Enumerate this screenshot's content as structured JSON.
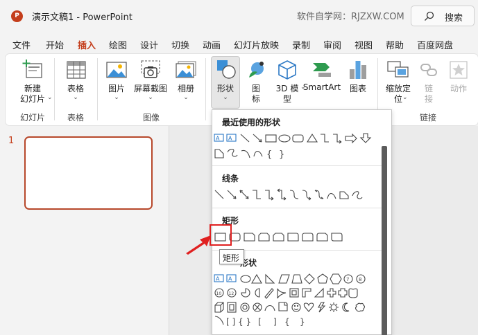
{
  "titlebar": {
    "app_icon": "P",
    "doc_title": "演示文稿1  -  PowerPoint",
    "watermark": "软件自学网：RJZXW.COM",
    "search_label": "搜索"
  },
  "menu": [
    "文件",
    "开始",
    "插入",
    "绘图",
    "设计",
    "切换",
    "动画",
    "幻灯片放映",
    "录制",
    "审阅",
    "视图",
    "帮助",
    "百度网盘"
  ],
  "active_tab": "插入",
  "ribbon": {
    "new_slide": [
      "新建",
      "幻灯片"
    ],
    "table": "表格",
    "picture": "图片",
    "screenshot": "屏幕截图",
    "album": "相册",
    "shapes": "形状",
    "icons": [
      "图",
      "标"
    ],
    "model3d": [
      "3D 模",
      "型"
    ],
    "smartart": "SmartArt",
    "chart": "图表",
    "zoom": [
      "缩放定",
      "位"
    ],
    "link": [
      "链",
      "接"
    ],
    "action": "动作",
    "groups": {
      "slides": "幻灯片",
      "tables": "表格",
      "images": "图像",
      "links": "链接"
    }
  },
  "slides": {
    "number": "1"
  },
  "dropdown": {
    "sections": [
      "最近使用的形状",
      "线条",
      "矩形",
      "基本形状"
    ],
    "basic_shapes_visible": "形状"
  },
  "tooltip": "矩形",
  "colors": {
    "accent": "#c43e1c",
    "highlight": "#e02020"
  }
}
